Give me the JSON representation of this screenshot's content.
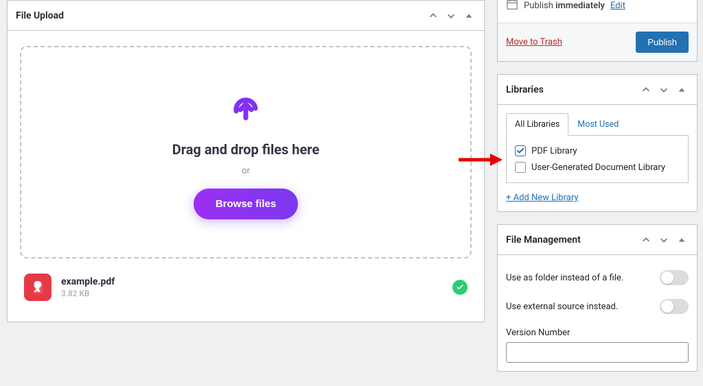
{
  "file_upload": {
    "title": "File Upload",
    "dropzone": {
      "heading": "Drag and drop files here",
      "or_text": "or",
      "browse_label": "Browse files"
    },
    "uploaded_file": {
      "name": "example.pdf",
      "size": "3.82 KB",
      "icon": "pdf-icon",
      "status": "success"
    }
  },
  "publish": {
    "schedule_label_prefix": "Publish ",
    "schedule_value": "immediately",
    "edit_label": "Edit",
    "trash_label": "Move to Trash",
    "publish_label": "Publish"
  },
  "libraries": {
    "title": "Libraries",
    "tabs": {
      "all": "All Libraries",
      "most_used": "Most Used",
      "active": "all"
    },
    "items": [
      {
        "label": "PDF Library",
        "checked": true
      },
      {
        "label": "User-Generated Document Library",
        "checked": false
      }
    ],
    "add_label": "+ Add New Library"
  },
  "file_management": {
    "title": "File Management",
    "options": [
      {
        "label": "Use as folder instead of a file.",
        "value": false
      },
      {
        "label": "Use external source instead.",
        "value": false
      }
    ],
    "version_label": "Version Number",
    "version_value": ""
  },
  "colors": {
    "accent_purple": "#8231f1",
    "wp_blue": "#2271b1",
    "danger": "#b32d2e",
    "pdf_red": "#e63946",
    "success": "#2ecc71"
  }
}
